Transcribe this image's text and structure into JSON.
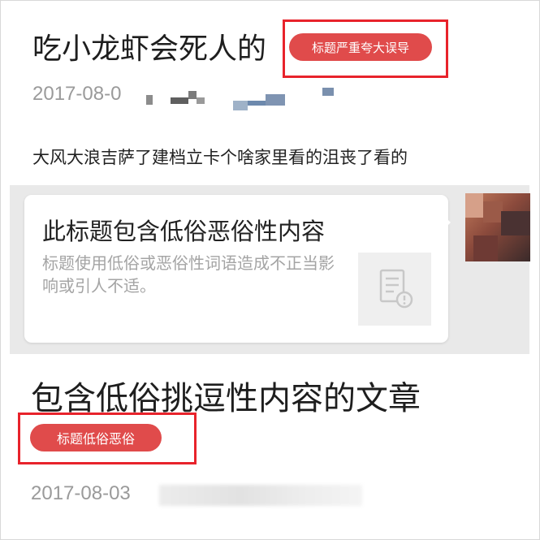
{
  "card1": {
    "title": "吃小龙虾会死人的",
    "tag": "标题严重夸大误导",
    "date": "2017-08-0",
    "excerpt": "大风大浪吉萨了建档立卡个啥家里看的沮丧了看的"
  },
  "tooltip": {
    "title": "此标题包含低俗恶俗性内容",
    "description": "标题使用低俗或恶俗性词语造成不正当影响或引人不适。",
    "icon": "document-warning-icon"
  },
  "card2": {
    "title": "包含低俗挑逗性内容的文章",
    "tag": "标题低俗恶俗",
    "date": "2017-08-03"
  },
  "colors": {
    "highlight_box": "#e8232b",
    "tag_fill": "#e04b4b",
    "meta_gray": "#9a9a9a"
  }
}
